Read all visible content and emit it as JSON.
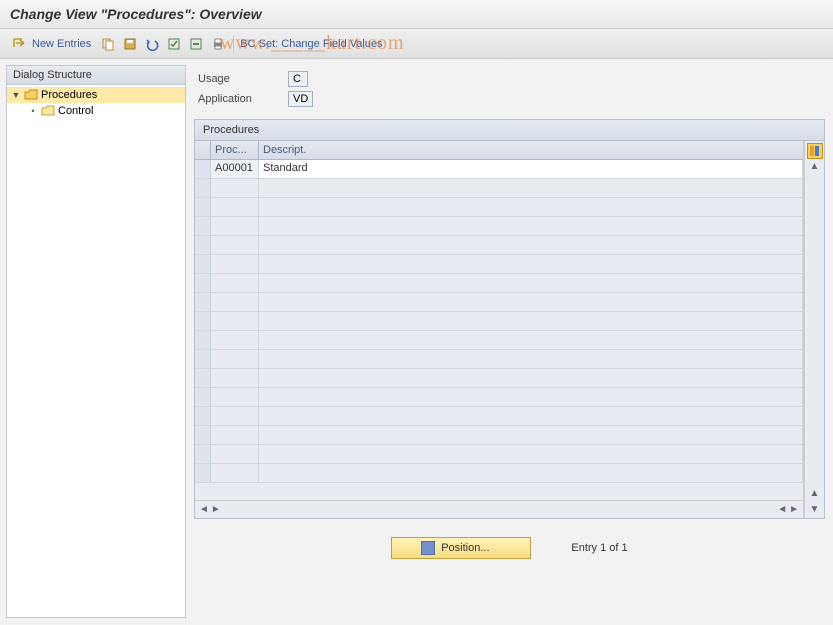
{
  "title": "Change View \"Procedures\": Overview",
  "toolbar": {
    "new_entries": "New Entries",
    "bc_set_link": "BC Set: Change Field Values"
  },
  "sidebar": {
    "header": "Dialog Structure",
    "items": [
      {
        "label": "Procedures",
        "selected": true,
        "indent": 0,
        "expanded": true
      },
      {
        "label": "Control",
        "selected": false,
        "indent": 1,
        "expanded": false
      }
    ]
  },
  "fields": {
    "usage_label": "Usage",
    "usage_value": "C",
    "application_label": "Application",
    "application_value": "VD"
  },
  "panel": {
    "title": "Procedures",
    "columns": {
      "col1": "Proc...",
      "col2": "Descript."
    },
    "rows": [
      {
        "proc": "A00001",
        "desc": "Standard"
      }
    ],
    "empty_rows": 16
  },
  "footer": {
    "position_label": "Position...",
    "entry_text": "Entry 1 of 1"
  },
  "watermark": "www._____kart.com"
}
